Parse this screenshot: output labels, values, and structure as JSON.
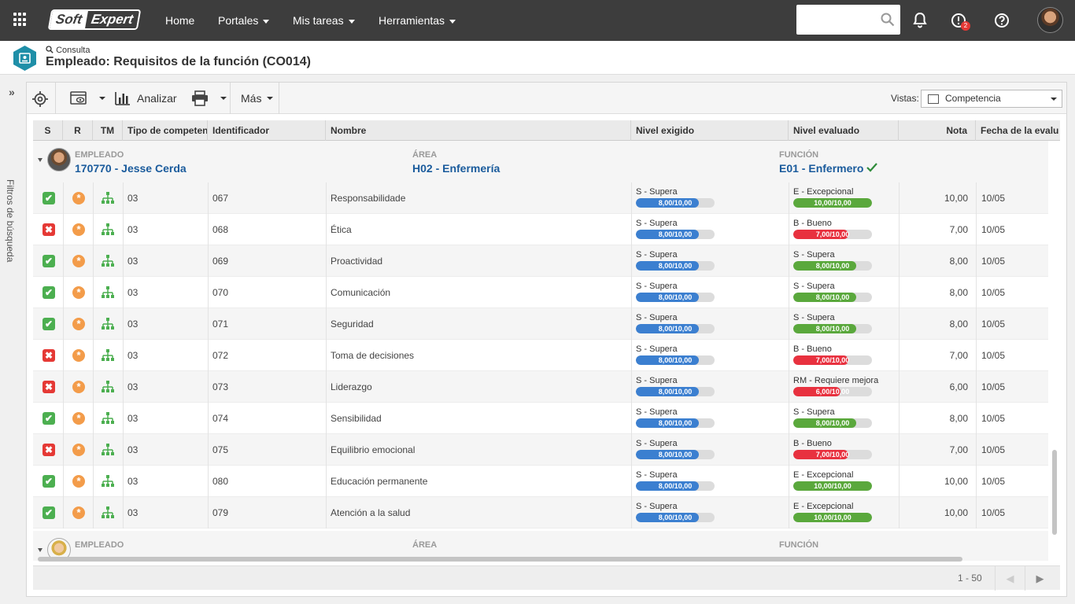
{
  "app": {
    "logo_left": "Soft",
    "logo_right": "Expert"
  },
  "nav": {
    "home": "Home",
    "portales": "Portales",
    "mis_tareas": "Mis tareas",
    "herramientas": "Herramientas"
  },
  "notifications": {
    "badge": "2"
  },
  "header": {
    "crumb": "Consulta",
    "title": "Empleado: Requisitos de la función (CO014)"
  },
  "sidebar": {
    "filter_label": "Filtros de búsqueda"
  },
  "toolbar": {
    "analizar": "Analizar",
    "mas": "Más",
    "vistas_label": "Vistas:",
    "vistas_value": "Competencia"
  },
  "columns": {
    "s": "S",
    "r": "R",
    "tm": "TM",
    "tipo": "Tipo de competen",
    "id": "Identificador",
    "nombre": "Nombre",
    "nivel_exigido": "Nivel exigido",
    "nivel_evaluado": "Nivel evaluado",
    "nota": "Nota",
    "fecha": "Fecha de la evalu"
  },
  "groups": [
    {
      "empleado_label": "EMPLEADO",
      "empleado": "170770 - Jesse Cerda",
      "area_label": "ÁREA",
      "area": "H02 - Enfermería",
      "funcion_label": "FUNCIÓN",
      "funcion": "E01 - Enfermero"
    },
    {
      "empleado_label": "EMPLEADO",
      "empleado": "",
      "area_label": "ÁREA",
      "area": "",
      "funcion_label": "FUNCIÓN",
      "funcion": ""
    }
  ],
  "rows": [
    {
      "s": "ok",
      "tipo": "03",
      "id": "067",
      "nombre": "Responsabilidade",
      "req_label": "S - Supera",
      "req_text": "8,00/10,00",
      "req_frac": 0.8,
      "ev_label": "E - Excepcional",
      "ev_text": "10,00/10,00",
      "ev_frac": 1.0,
      "ev_color": "#5aa83c",
      "nota": "10,00",
      "fecha": "10/05"
    },
    {
      "s": "no",
      "tipo": "03",
      "id": "068",
      "nombre": "Ética",
      "req_label": "S - Supera",
      "req_text": "8,00/10,00",
      "req_frac": 0.8,
      "ev_label": "B - Bueno",
      "ev_text": "7,00/10,00",
      "ev_frac": 0.7,
      "ev_color": "#e8313f",
      "nota": "7,00",
      "fecha": "10/05"
    },
    {
      "s": "ok",
      "tipo": "03",
      "id": "069",
      "nombre": "Proactividad",
      "req_label": "S - Supera",
      "req_text": "8,00/10,00",
      "req_frac": 0.8,
      "ev_label": "S - Supera",
      "ev_text": "8,00/10,00",
      "ev_frac": 0.8,
      "ev_color": "#5aa83c",
      "nota": "8,00",
      "fecha": "10/05"
    },
    {
      "s": "ok",
      "tipo": "03",
      "id": "070",
      "nombre": "Comunicación",
      "req_label": "S - Supera",
      "req_text": "8,00/10,00",
      "req_frac": 0.8,
      "ev_label": "S - Supera",
      "ev_text": "8,00/10,00",
      "ev_frac": 0.8,
      "ev_color": "#5aa83c",
      "nota": "8,00",
      "fecha": "10/05"
    },
    {
      "s": "ok",
      "tipo": "03",
      "id": "071",
      "nombre": "Seguridad",
      "req_label": "S - Supera",
      "req_text": "8,00/10,00",
      "req_frac": 0.8,
      "ev_label": "S - Supera",
      "ev_text": "8,00/10,00",
      "ev_frac": 0.8,
      "ev_color": "#5aa83c",
      "nota": "8,00",
      "fecha": "10/05"
    },
    {
      "s": "no",
      "tipo": "03",
      "id": "072",
      "nombre": "Toma de decisiones",
      "req_label": "S - Supera",
      "req_text": "8,00/10,00",
      "req_frac": 0.8,
      "ev_label": "B - Bueno",
      "ev_text": "7,00/10,00",
      "ev_frac": 0.7,
      "ev_color": "#e8313f",
      "nota": "7,00",
      "fecha": "10/05"
    },
    {
      "s": "no",
      "tipo": "03",
      "id": "073",
      "nombre": "Liderazgo",
      "req_label": "S - Supera",
      "req_text": "8,00/10,00",
      "req_frac": 0.8,
      "ev_label": "RM - Requiere mejora",
      "ev_text": "6,00/10,00",
      "ev_frac": 0.6,
      "ev_color": "#e8313f",
      "nota": "6,00",
      "fecha": "10/05"
    },
    {
      "s": "ok",
      "tipo": "03",
      "id": "074",
      "nombre": "Sensibilidad",
      "req_label": "S - Supera",
      "req_text": "8,00/10,00",
      "req_frac": 0.8,
      "ev_label": "S - Supera",
      "ev_text": "8,00/10,00",
      "ev_frac": 0.8,
      "ev_color": "#5aa83c",
      "nota": "8,00",
      "fecha": "10/05"
    },
    {
      "s": "no",
      "tipo": "03",
      "id": "075",
      "nombre": "Equilibrio emocional",
      "req_label": "S - Supera",
      "req_text": "8,00/10,00",
      "req_frac": 0.8,
      "ev_label": "B - Bueno",
      "ev_text": "7,00/10,00",
      "ev_frac": 0.7,
      "ev_color": "#e8313f",
      "nota": "7,00",
      "fecha": "10/05"
    },
    {
      "s": "ok",
      "tipo": "03",
      "id": "080",
      "nombre": "Educación permanente",
      "req_label": "S - Supera",
      "req_text": "8,00/10,00",
      "req_frac": 0.8,
      "ev_label": "E - Excepcional",
      "ev_text": "10,00/10,00",
      "ev_frac": 1.0,
      "ev_color": "#5aa83c",
      "nota": "10,00",
      "fecha": "10/05"
    },
    {
      "s": "ok",
      "tipo": "03",
      "id": "079",
      "nombre": "Atención a la salud",
      "req_label": "S - Supera",
      "req_text": "8,00/10,00",
      "req_frac": 0.8,
      "ev_label": "E - Excepcional",
      "ev_text": "10,00/10,00",
      "ev_frac": 1.0,
      "ev_color": "#5aa83c",
      "nota": "10,00",
      "fecha": "10/05"
    }
  ],
  "colors": {
    "req_bar": "#3b7fd0",
    "bar_track": "#dcdcdc"
  },
  "pager": {
    "range": "1 - 50"
  }
}
